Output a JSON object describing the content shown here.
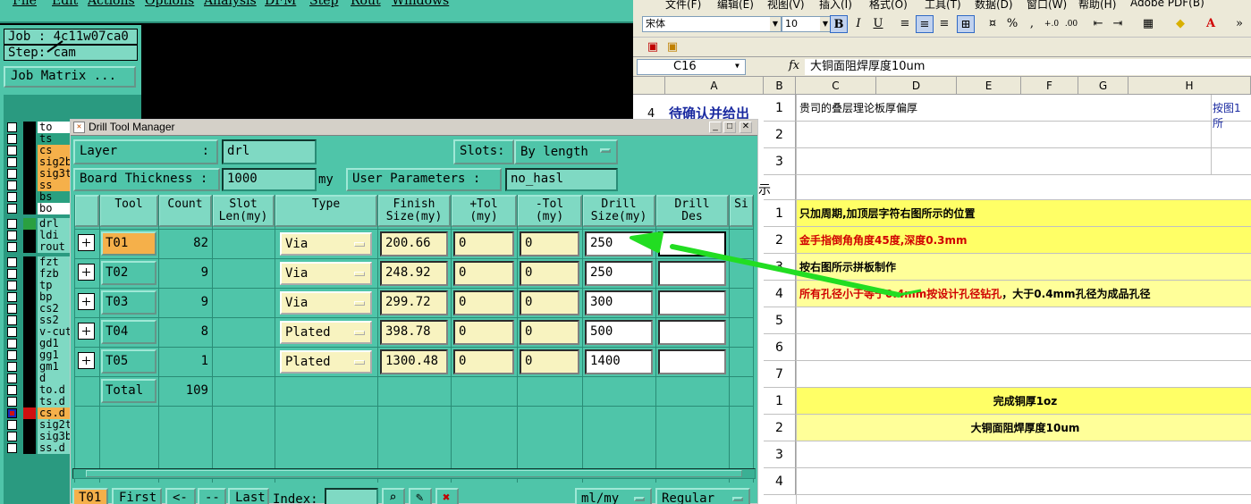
{
  "cam": {
    "menu": [
      "File",
      "Edit",
      "Actions",
      "Options",
      "Analysis",
      "DFM",
      "Step",
      "Rout",
      "Windows"
    ],
    "job_label": "Job : 4c11w07ca0",
    "step_label": "Step: cam",
    "job_matrix_button": "Job Matrix ...",
    "layers": [
      {
        "name": "to",
        "color": "#ffffff"
      },
      {
        "name": "ts",
        "color": "#2aa080"
      },
      {
        "name": "cs",
        "color": "#f5b04a"
      },
      {
        "name": "sig2b",
        "color": "#f5b04a"
      },
      {
        "name": "sig3t",
        "color": "#f5b04a"
      },
      {
        "name": "ss",
        "color": "#f5b04a"
      },
      {
        "name": "bs",
        "color": "#2aa080"
      },
      {
        "name": "bo",
        "color": "#ffffff"
      },
      {
        "name": "drl",
        "color": "#7fd9c3",
        "marker": "#2aa040"
      },
      {
        "name": "ldi",
        "color": "#7fd9c3"
      },
      {
        "name": "rout",
        "color": "#7fd9c3"
      },
      {
        "name": "fzt",
        "color": "#7fd9c3"
      },
      {
        "name": "fzb",
        "color": "#7fd9c3"
      },
      {
        "name": "tp",
        "color": "#7fd9c3"
      },
      {
        "name": "bp",
        "color": "#7fd9c3"
      },
      {
        "name": "cs2",
        "color": "#7fd9c3"
      },
      {
        "name": "ss2",
        "color": "#7fd9c3"
      },
      {
        "name": "v-cut",
        "color": "#7fd9c3"
      },
      {
        "name": "gd1",
        "color": "#7fd9c3"
      },
      {
        "name": "gg1",
        "color": "#7fd9c3"
      },
      {
        "name": "gm1",
        "color": "#7fd9c3"
      },
      {
        "name": "d",
        "color": "#7fd9c3"
      },
      {
        "name": "to.d",
        "color": "#7fd9c3"
      },
      {
        "name": "ts.d",
        "color": "#7fd9c3"
      },
      {
        "name": "cs.d",
        "color": "#f5b04a",
        "marker": "#d01010",
        "selected": true
      },
      {
        "name": "sig2t",
        "color": "#7fd9c3"
      },
      {
        "name": "sig3b",
        "color": "#7fd9c3"
      },
      {
        "name": "ss.d",
        "color": "#7fd9c3"
      }
    ]
  },
  "dtm": {
    "title": "Drill Tool Manager",
    "layer_label": "Layer",
    "layer_colon": ":",
    "layer_value": "drl",
    "slots_label": "Slots:",
    "slots_value": "By length",
    "board_thickness_label": "Board Thickness :",
    "board_thickness_value": "1000",
    "board_thickness_unit": "my",
    "user_params_label": "User Parameters :",
    "user_params_value": "no_hasl",
    "headers": [
      "Tool",
      "Count",
      "Slot\nLen(my)",
      "Type",
      "Finish\nSize(my)",
      "+Tol\n(my)",
      "-Tol\n(my)",
      "Drill\nSize(my)",
      "Drill\nDes",
      "Si"
    ],
    "rows": [
      {
        "tool": "T01",
        "count": "82",
        "type": "Via",
        "finish": "200.66",
        "ptol": "0",
        "ntol": "0",
        "drill": "250",
        "des": ""
      },
      {
        "tool": "T02",
        "count": "9",
        "type": "Via",
        "finish": "248.92",
        "ptol": "0",
        "ntol": "0",
        "drill": "250",
        "des": ""
      },
      {
        "tool": "T03",
        "count": "9",
        "type": "Via",
        "finish": "299.72",
        "ptol": "0",
        "ntol": "0",
        "drill": "300",
        "des": ""
      },
      {
        "tool": "T04",
        "count": "8",
        "type": "Plated",
        "finish": "398.78",
        "ptol": "0",
        "ntol": "0",
        "drill": "500",
        "des": ""
      },
      {
        "tool": "T05",
        "count": "1",
        "type": "Plated",
        "finish": "1300.48",
        "ptol": "0",
        "ntol": "0",
        "drill": "1400",
        "des": ""
      }
    ],
    "total_label": "Total",
    "total_count": "109",
    "bottom": {
      "current_tool": "T01",
      "first": "First",
      "prev": "<--",
      "next": "-->",
      "last": "Last",
      "index_label": "Index:",
      "units": "ml/my",
      "mode": "Regular"
    }
  },
  "excel": {
    "menu": [
      "文件(F)",
      "编辑(E)",
      "视图(V)",
      "插入(I)",
      "格式(O)",
      "工具(T)",
      "数据(D)",
      "窗口(W)",
      "帮助(H)",
      "Adobe PDF(B)"
    ],
    "font_name": "宋体",
    "font_size": "10",
    "name_box": "C16",
    "fx": "fx",
    "formula": "大铜面阻焊厚度10um",
    "columns": [
      "A",
      "B",
      "C",
      "D",
      "E",
      "F",
      "G",
      "H"
    ],
    "a_col_text": "待确认并给出",
    "a_col_num": "4",
    "section_text": "示",
    "side_note": "按图1所",
    "rows": [
      {
        "num": "1",
        "text": "贵司的叠层理论板厚偏厚",
        "style": "plain"
      },
      {
        "num": "2",
        "text": "",
        "style": "plain"
      },
      {
        "num": "3",
        "text": "",
        "style": "plain"
      },
      {
        "num": "",
        "text": "",
        "style": "plain"
      },
      {
        "num": "1",
        "text": "只加周期,加顶层字符右图所示的位置",
        "style": "yellow"
      },
      {
        "num": "2",
        "text": "金手指倒角角度45度,深度0.3mm",
        "style": "yellow-red"
      },
      {
        "num": "3",
        "text": "按右图所示拼板制作",
        "style": "lightyellow"
      },
      {
        "num": "4",
        "text": "所有孔径小于等于0.4mm按设计孔径钻孔，大于0.4mm孔径为成品孔径",
        "style": "lightyellow-mixed"
      },
      {
        "num": "5",
        "text": "",
        "style": "plain"
      },
      {
        "num": "6",
        "text": "",
        "style": "plain"
      },
      {
        "num": "7",
        "text": "",
        "style": "plain"
      },
      {
        "num": "1",
        "text": "完成铜厚1oz",
        "style": "yellow-center"
      },
      {
        "num": "2",
        "text": "大铜面阻焊厚度10um",
        "style": "lightyellow-center"
      },
      {
        "num": "3",
        "text": "",
        "style": "plain"
      },
      {
        "num": "4",
        "text": "",
        "style": "plain"
      }
    ]
  },
  "colors": {
    "cam_bg": "#4fc5a9",
    "accent_arrow": "#22dd22",
    "tool_active": "#f5b04a"
  }
}
